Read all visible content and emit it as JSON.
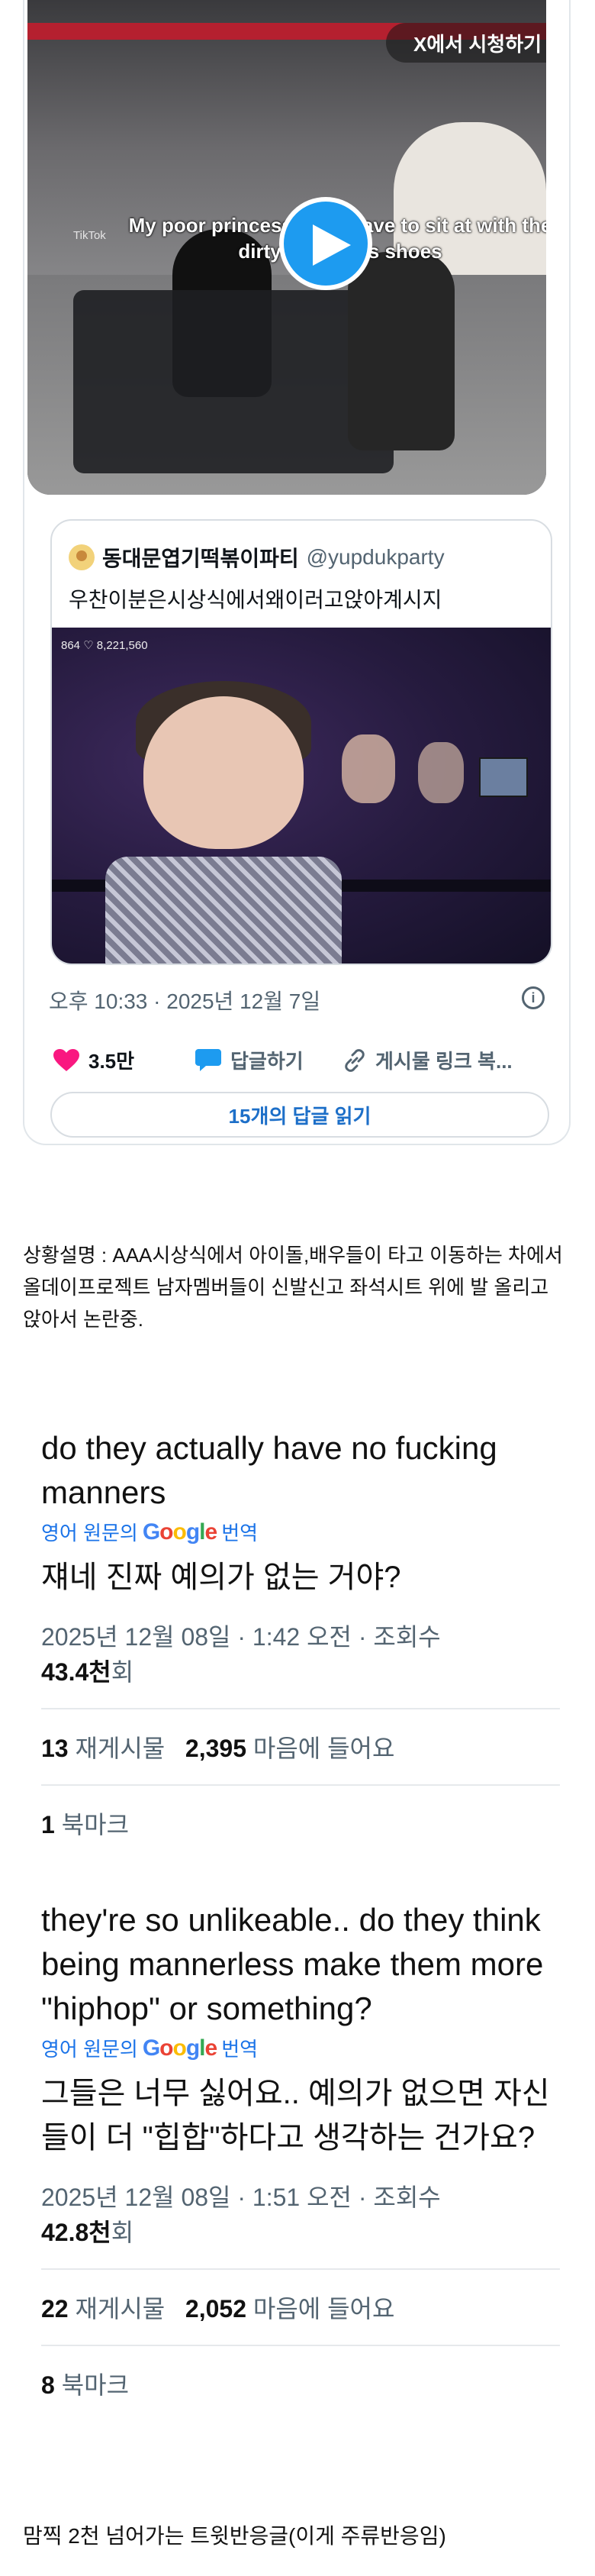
{
  "video": {
    "watch_label": "X에서 시청하기",
    "caption": "My poor princess, they have to sit at with the dirty footprints shoes",
    "tiktok": "TikTok"
  },
  "quote": {
    "author_name": "동대문엽기떡볶이파티",
    "author_handle": "@yupdukparty",
    "text": "우찬이분은시상식에서왜이러고앉아계시지",
    "image_stats": "864 ♡ 8,221,560"
  },
  "tweet": {
    "timestamp": "오후 10:33 · 2025년 12월 7일",
    "likes": "3.5만",
    "reply_label": "답글하기",
    "share_label": "게시물 링크 복...",
    "read_replies": "15개의 답글 읽기"
  },
  "explanation": "상황설명 : AAA시상식에서 아이돌,배우들이 타고 이동하는 차에서 올데이프로젝트 남자멤버들이 신발신고 좌석시트 위에 발 올리고 앉아서 논란중.",
  "translate": {
    "prefix": "영어 원문의",
    "google": "Google",
    "suffix": "번역"
  },
  "replies": [
    {
      "original": "do they actually have no fucking manners",
      "translation": "쟤네 진짜 예의가 없는 거야?",
      "meta": "2025년 12월 08일 · 1:42 오전 · 조회수",
      "views": "43.4천",
      "views_suffix": "회",
      "reposts": "13",
      "reposts_label": "재게시물",
      "likes": "2,395",
      "likes_label": "마음에 들어요",
      "bookmarks": "1",
      "bookmarks_label": "북마크"
    },
    {
      "original": "they're so unlikeable.. do they think being mannerless make them more \"hiphop\" or something?",
      "translation": "그들은 너무 싫어요.. 예의가 없으면 자신들이 더 \"힙합\"하다고 생각하는 건가요?",
      "meta": "2025년 12월 08일 · 1:51 오전 · 조회수",
      "views": "42.8천",
      "views_suffix": "회",
      "reposts": "22",
      "reposts_label": "재게시물",
      "likes": "2,052",
      "likes_label": "마음에 들어요",
      "bookmarks": "8",
      "bookmarks_label": "북마크"
    }
  ],
  "footer": "맘찍 2천 넘어가는 트윗반응글(이게 주류반응임)",
  "colors": {
    "accent": "#1d9bf0",
    "like": "#f91880",
    "link": "#1a73e8"
  }
}
